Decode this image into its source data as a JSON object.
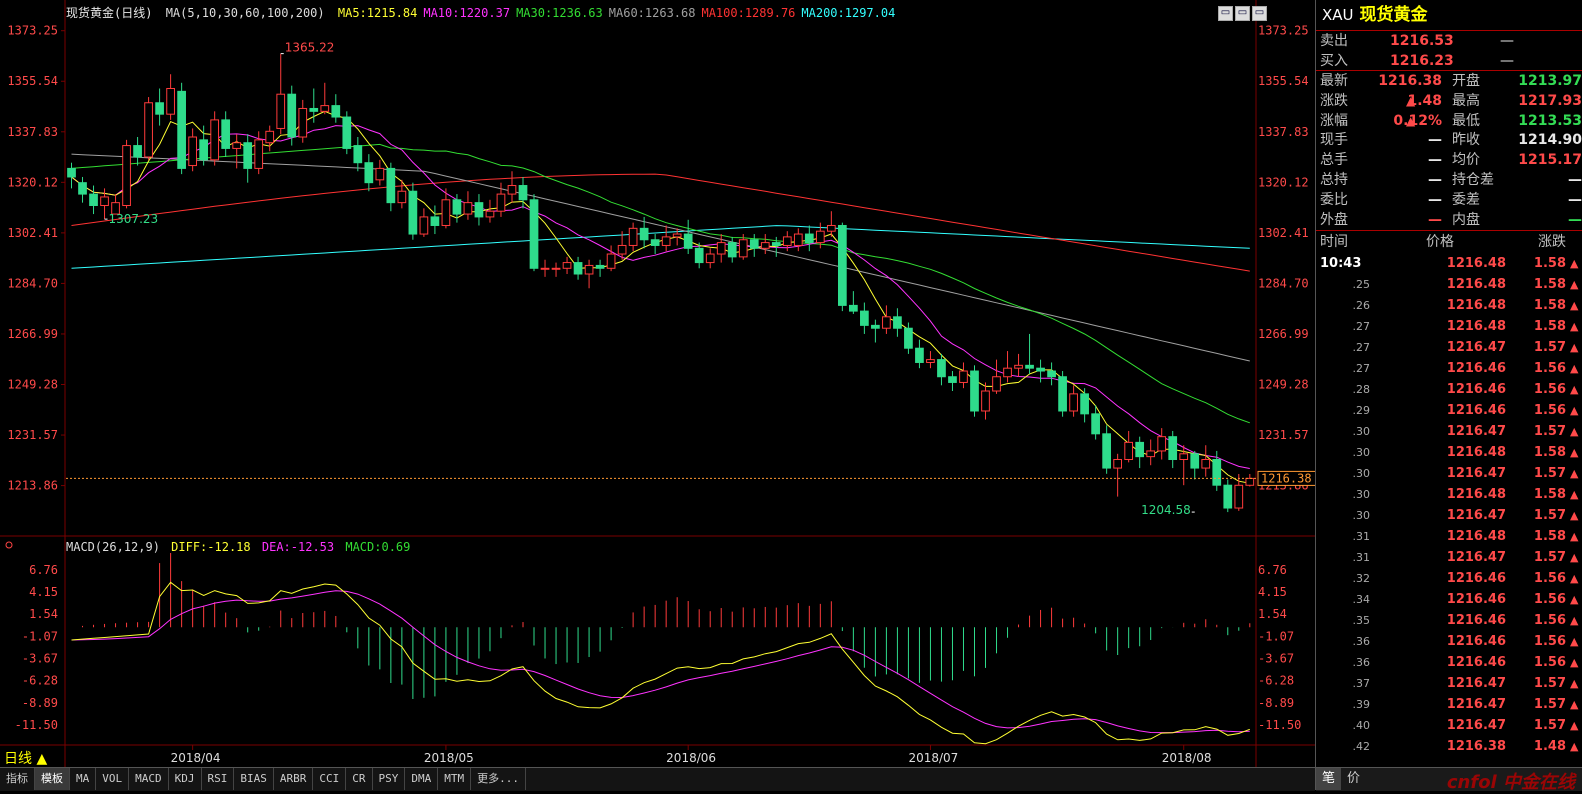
{
  "legend": {
    "title": "现货黄金(日线)",
    "ma_params": "MA(5,10,30,60,100,200)",
    "items": [
      {
        "label": "MA5:1215.84",
        "color": "#ffff33"
      },
      {
        "label": "MA10:1220.37",
        "color": "#ff33ff"
      },
      {
        "label": "MA30:1236.63",
        "color": "#33dd33"
      },
      {
        "label": "MA60:1263.68",
        "color": "#a0a0a0"
      },
      {
        "label": "MA100:1289.76",
        "color": "#ff3333"
      },
      {
        "label": "MA200:1297.04",
        "color": "#33ffff"
      }
    ]
  },
  "macd_legend": {
    "params": "MACD(26,12,9)",
    "diff": "DIFF:-12.18",
    "dea": "DEA:-12.53",
    "macd": "MACD:0.69"
  },
  "chart_data": {
    "type": "candlestick",
    "y_ticks": [
      "1373.25",
      "1355.54",
      "1337.83",
      "1320.12",
      "1302.41",
      "1284.70",
      "1266.99",
      "1249.28",
      "1231.57",
      "1213.86"
    ],
    "ylim": [
      1199,
      1377
    ],
    "macd_ticks": [
      "6.76",
      "4.15",
      "1.54",
      "-1.07",
      "-3.67",
      "-6.28",
      "-8.89",
      "-11.50"
    ],
    "macd_ylim": [
      -13.5,
      8.5
    ],
    "x_labels": [
      "2018/04",
      "2018/05",
      "2018/06",
      "2018/07",
      "2018/08"
    ],
    "x_label_index": [
      11,
      34,
      56,
      78,
      101
    ],
    "last_price_label": "1216.38",
    "last_price": 1216.38,
    "annotations": [
      {
        "label": "1365.22",
        "index": 19,
        "value": 1365.22
      },
      {
        "label": "1307.23",
        "index": 3,
        "value": 1307.23
      },
      {
        "label": "1204.58",
        "index": 102,
        "value": 1204.58
      }
    ],
    "candles": [
      [
        1325,
        1322,
        1327,
        1318
      ],
      [
        1320,
        1316,
        1322,
        1313
      ],
      [
        1316,
        1312,
        1319,
        1309
      ],
      [
        1312,
        1315,
        1318,
        1307.23
      ],
      [
        1309,
        1313,
        1316,
        1310
      ],
      [
        1312,
        1333,
        1335,
        1311
      ],
      [
        1333,
        1329,
        1336,
        1326
      ],
      [
        1329,
        1348,
        1350,
        1328
      ],
      [
        1348,
        1344,
        1353,
        1340
      ],
      [
        1344,
        1353,
        1358,
        1342
      ],
      [
        1352,
        1325,
        1355,
        1323
      ],
      [
        1326,
        1336,
        1339,
        1324
      ],
      [
        1335,
        1328,
        1340,
        1326
      ],
      [
        1328,
        1342,
        1345,
        1326
      ],
      [
        1342,
        1332,
        1345,
        1329
      ],
      [
        1332,
        1334,
        1337,
        1325
      ],
      [
        1334,
        1325,
        1337,
        1320
      ],
      [
        1325,
        1335,
        1338,
        1323
      ],
      [
        1334,
        1338,
        1340,
        1331
      ],
      [
        1339,
        1351,
        1365.22,
        1337
      ],
      [
        1351,
        1336,
        1354,
        1333
      ],
      [
        1336,
        1346,
        1349,
        1334
      ],
      [
        1346,
        1345,
        1353,
        1341
      ],
      [
        1345,
        1347,
        1355,
        1344
      ],
      [
        1347,
        1343,
        1351,
        1341
      ],
      [
        1343,
        1332,
        1345,
        1330
      ],
      [
        1333,
        1327,
        1336,
        1324
      ],
      [
        1327,
        1320,
        1330,
        1317
      ],
      [
        1321,
        1325,
        1328,
        1319
      ],
      [
        1325,
        1313,
        1327,
        1310
      ],
      [
        1313,
        1317,
        1321,
        1311
      ],
      [
        1317,
        1302,
        1320,
        1300
      ],
      [
        1302,
        1308,
        1311,
        1301
      ],
      [
        1308,
        1305,
        1312,
        1302
      ],
      [
        1305,
        1314,
        1318,
        1304
      ],
      [
        1314,
        1309,
        1316,
        1306
      ],
      [
        1309,
        1313,
        1317,
        1307
      ],
      [
        1313,
        1308,
        1316,
        1305
      ],
      [
        1308,
        1310,
        1314,
        1306
      ],
      [
        1310,
        1316,
        1320,
        1308
      ],
      [
        1316,
        1319,
        1324,
        1313
      ],
      [
        1319,
        1314,
        1322,
        1311
      ],
      [
        1314,
        1290,
        1316,
        1289
      ],
      [
        1290,
        1290,
        1293,
        1287
      ],
      [
        1290,
        1290,
        1292,
        1287
      ],
      [
        1290,
        1292,
        1294,
        1288
      ],
      [
        1292,
        1288,
        1294,
        1286
      ],
      [
        1288,
        1291,
        1293,
        1283
      ],
      [
        1291,
        1290,
        1293,
        1287
      ],
      [
        1290,
        1295,
        1298,
        1289
      ],
      [
        1295,
        1298,
        1303,
        1293
      ],
      [
        1298,
        1304,
        1306,
        1296
      ],
      [
        1304,
        1300,
        1308,
        1297
      ],
      [
        1300,
        1298,
        1302,
        1295
      ],
      [
        1298,
        1301,
        1305,
        1296
      ],
      [
        1301,
        1302,
        1304,
        1298
      ],
      [
        1302,
        1297,
        1307,
        1295
      ],
      [
        1297,
        1292,
        1299,
        1290
      ],
      [
        1292,
        1295,
        1297,
        1290
      ],
      [
        1295,
        1299,
        1302,
        1292
      ],
      [
        1299,
        1294,
        1301,
        1292
      ],
      [
        1294,
        1300,
        1302,
        1293
      ],
      [
        1300,
        1297,
        1302,
        1294
      ],
      [
        1297,
        1299,
        1302,
        1295
      ],
      [
        1299,
        1298,
        1301,
        1294
      ],
      [
        1298,
        1301,
        1303,
        1296
      ],
      [
        1298,
        1302,
        1304,
        1296
      ],
      [
        1302,
        1299,
        1305,
        1296
      ],
      [
        1299,
        1303,
        1306,
        1297
      ],
      [
        1303,
        1305,
        1310,
        1301
      ],
      [
        1305,
        1277,
        1306,
        1275
      ],
      [
        1277,
        1275,
        1282,
        1274
      ],
      [
        1275,
        1270,
        1278,
        1267
      ],
      [
        1270,
        1269,
        1272,
        1264
      ],
      [
        1269,
        1273,
        1277,
        1267
      ],
      [
        1273,
        1269,
        1276,
        1266
      ],
      [
        1269,
        1262,
        1271,
        1260
      ],
      [
        1262,
        1257,
        1265,
        1255
      ],
      [
        1257,
        1258,
        1261,
        1255
      ],
      [
        1258,
        1252,
        1260,
        1249
      ],
      [
        1252,
        1250,
        1254,
        1247
      ],
      [
        1250,
        1254,
        1257,
        1248
      ],
      [
        1254,
        1240,
        1256,
        1238
      ],
      [
        1240,
        1247,
        1250,
        1237
      ],
      [
        1247,
        1252,
        1258,
        1246
      ],
      [
        1252,
        1255,
        1261,
        1250
      ],
      [
        1255,
        1256,
        1260,
        1252
      ],
      [
        1256,
        1255,
        1267,
        1253
      ],
      [
        1255,
        1254,
        1258,
        1250
      ],
      [
        1254,
        1252,
        1257,
        1249
      ],
      [
        1252,
        1240,
        1254,
        1238
      ],
      [
        1240,
        1246,
        1249,
        1238
      ],
      [
        1246,
        1239,
        1248,
        1236
      ],
      [
        1239,
        1232,
        1242,
        1230
      ],
      [
        1232,
        1220,
        1235,
        1218
      ],
      [
        1220,
        1223,
        1225,
        1210
      ],
      [
        1223,
        1229,
        1233,
        1222
      ],
      [
        1229,
        1224,
        1231,
        1220
      ],
      [
        1224,
        1226,
        1230,
        1221
      ],
      [
        1226,
        1231,
        1234,
        1223
      ],
      [
        1231,
        1223,
        1233,
        1220
      ],
      [
        1223,
        1225,
        1228,
        1214
      ],
      [
        1225,
        1220,
        1226,
        1216
      ],
      [
        1220,
        1223,
        1228,
        1217
      ],
      [
        1223,
        1214,
        1226,
        1212
      ],
      [
        1214,
        1206,
        1216,
        1204.58
      ],
      [
        1206,
        1213.97,
        1217.93,
        1205
      ],
      [
        1213.97,
        1216.38,
        1217.93,
        1213.53
      ]
    ]
  },
  "panel": {
    "code": "XAU",
    "name": "现货黄金",
    "sell": {
      "label": "卖出",
      "value": "1216.53",
      "extra": "—"
    },
    "buy": {
      "label": "买入",
      "value": "1216.23",
      "extra": "—"
    },
    "quotes": [
      {
        "l1": "最新",
        "v1": "1216.38",
        "c1": "red",
        "l2": "开盘",
        "v2": "1213.97",
        "c2": "grn"
      },
      {
        "l1": "涨跌",
        "v1": "1.48",
        "c1": "red",
        "arrow": true,
        "l2": "最高",
        "v2": "1217.93",
        "c2": "red"
      },
      {
        "l1": "涨幅",
        "v1": "0.12%",
        "c1": "red",
        "arrow": true,
        "l2": "最低",
        "v2": "1213.53",
        "c2": "grn"
      },
      {
        "l1": "现手",
        "v1": "—",
        "c1": "wht",
        "l2": "昨收",
        "v2": "1214.90",
        "c2": "wht"
      },
      {
        "l1": "总手",
        "v1": "—",
        "c1": "wht",
        "l2": "均价",
        "v2": "1215.17",
        "c2": "red"
      },
      {
        "l1": "总持",
        "v1": "—",
        "c1": "wht",
        "l2": "持仓差",
        "v2": "—",
        "c2": "wht"
      },
      {
        "l1": "委比",
        "v1": "—",
        "c1": "wht",
        "l2": "委差",
        "v2": "—",
        "c2": "wht"
      },
      {
        "l1": "外盘",
        "v1": "—",
        "c1": "red",
        "l2": "内盘",
        "v2": "—",
        "c2": "grn"
      }
    ],
    "tick_headers": {
      "time": "时间",
      "price": "价格",
      "change": "涨跌"
    },
    "ticks": [
      {
        "t": "10:43",
        "p": "1216.48",
        "c": "1.58"
      },
      {
        "t": "25",
        "p": "1216.48",
        "c": "1.58"
      },
      {
        "t": "26",
        "p": "1216.48",
        "c": "1.58"
      },
      {
        "t": "27",
        "p": "1216.48",
        "c": "1.58"
      },
      {
        "t": "27",
        "p": "1216.47",
        "c": "1.57"
      },
      {
        "t": "27",
        "p": "1216.46",
        "c": "1.56"
      },
      {
        "t": "28",
        "p": "1216.46",
        "c": "1.56"
      },
      {
        "t": "29",
        "p": "1216.46",
        "c": "1.56"
      },
      {
        "t": "30",
        "p": "1216.47",
        "c": "1.57"
      },
      {
        "t": "30",
        "p": "1216.48",
        "c": "1.58"
      },
      {
        "t": "30",
        "p": "1216.47",
        "c": "1.57"
      },
      {
        "t": "30",
        "p": "1216.48",
        "c": "1.58"
      },
      {
        "t": "30",
        "p": "1216.47",
        "c": "1.57"
      },
      {
        "t": "31",
        "p": "1216.48",
        "c": "1.58"
      },
      {
        "t": "31",
        "p": "1216.47",
        "c": "1.57"
      },
      {
        "t": "32",
        "p": "1216.46",
        "c": "1.56"
      },
      {
        "t": "34",
        "p": "1216.46",
        "c": "1.56"
      },
      {
        "t": "35",
        "p": "1216.46",
        "c": "1.56"
      },
      {
        "t": "36",
        "p": "1216.46",
        "c": "1.56"
      },
      {
        "t": "36",
        "p": "1216.46",
        "c": "1.56"
      },
      {
        "t": "37",
        "p": "1216.47",
        "c": "1.57"
      },
      {
        "t": "39",
        "p": "1216.47",
        "c": "1.57"
      },
      {
        "t": "40",
        "p": "1216.47",
        "c": "1.57"
      },
      {
        "t": "42",
        "p": "1216.38",
        "c": "1.48"
      }
    ],
    "tabs": [
      "笔",
      "价"
    ],
    "watermark": "cnfol 中金在线"
  },
  "period": "日线",
  "tabs": [
    "指标",
    "模板",
    "MA",
    "VOL",
    "MACD",
    "KDJ",
    "RSI",
    "BIAS",
    "ARBR",
    "CCI",
    "CR",
    "PSY",
    "DMA",
    "MTM",
    "更多..."
  ],
  "window_buttons": [
    "▭",
    "▭",
    "▭"
  ],
  "colors": {
    "up": "#ff3b3b",
    "down": "#2fdc8c",
    "grid": "#7a0000"
  }
}
